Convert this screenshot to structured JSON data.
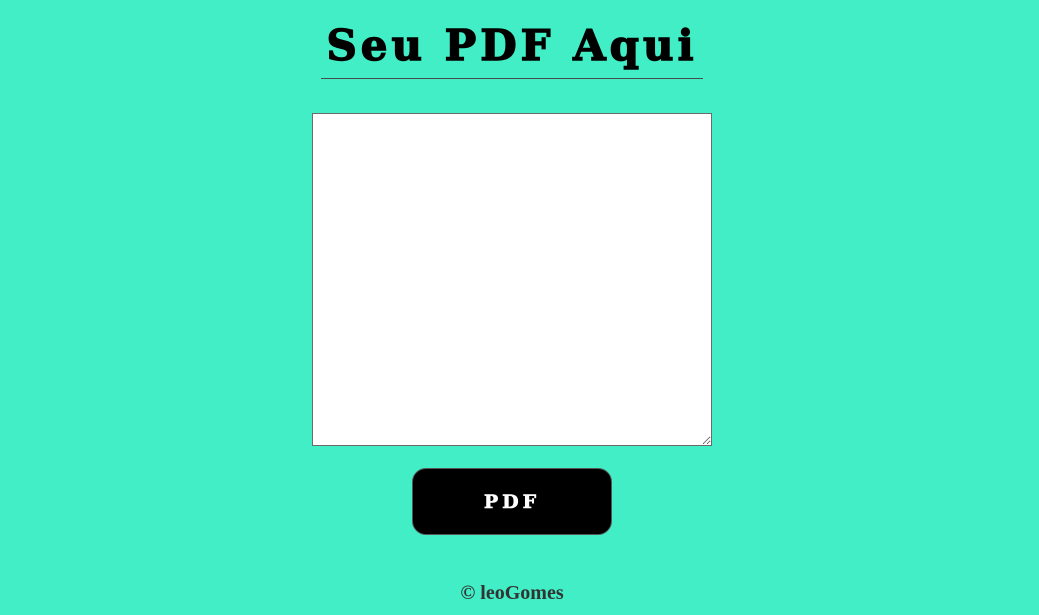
{
  "header": {
    "title": "Seu PDF Aqui"
  },
  "editor": {
    "value": "",
    "placeholder": ""
  },
  "actions": {
    "pdf_label": "PDF"
  },
  "footer": {
    "credit": "© leoGomes"
  },
  "colors": {
    "background": "#41eec5",
    "button": "#000000",
    "button_text": "#ffffff"
  }
}
